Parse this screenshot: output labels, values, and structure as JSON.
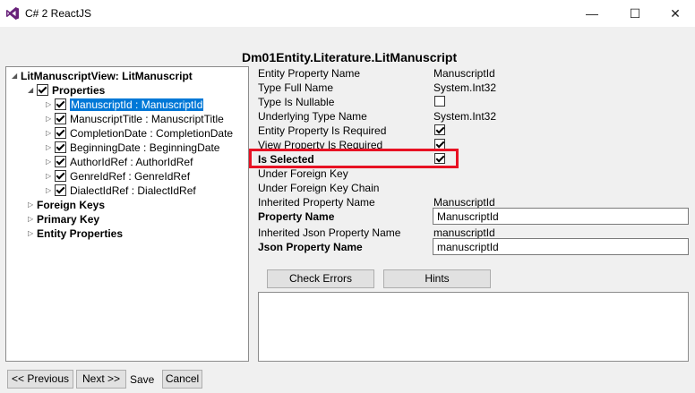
{
  "window": {
    "title": "C# 2 ReactJS",
    "minimize_glyph": "—",
    "maximize_glyph": "☐",
    "close_glyph": "✕"
  },
  "header": {
    "entity_title": "Dm01Entity.Literature.LitManuscript"
  },
  "tree": {
    "root": {
      "label": "LitManuscriptView: LitManuscript",
      "expander": "◢"
    },
    "properties": {
      "label": "Properties",
      "expander": "◢",
      "checked": true
    },
    "items": [
      {
        "label": "ManuscriptId : ManuscriptId",
        "checked": true,
        "selected": true
      },
      {
        "label": "ManuscriptTitle : ManuscriptTitle",
        "checked": true
      },
      {
        "label": "CompletionDate : CompletionDate",
        "checked": true
      },
      {
        "label": "BeginningDate : BeginningDate",
        "checked": true
      },
      {
        "label": "AuthorIdRef : AuthorIdRef",
        "checked": true
      },
      {
        "label": "GenreIdRef : GenreIdRef",
        "checked": true
      },
      {
        "label": "DialectIdRef : DialectIdRef",
        "checked": true
      }
    ],
    "item_expander": "▷",
    "sections": [
      {
        "label": "Foreign Keys",
        "expander": "▷"
      },
      {
        "label": "Primary Key",
        "expander": "▷"
      },
      {
        "label": "Entity Properties",
        "expander": "▷"
      }
    ]
  },
  "properties": {
    "entity_property_name": {
      "label": "Entity Property Name",
      "value": "ManuscriptId"
    },
    "type_full_name": {
      "label": "Type Full Name",
      "value": "System.Int32"
    },
    "type_is_nullable": {
      "label": "Type Is Nullable",
      "checked": false
    },
    "underlying_type_name": {
      "label": "Underlying Type Name",
      "value": "System.Int32"
    },
    "entity_property_is_required": {
      "label": "Entity Property Is Required",
      "checked": true
    },
    "view_property_is_required": {
      "label": "View Property Is Required",
      "checked": true
    },
    "is_selected": {
      "label": "Is Selected",
      "checked": true
    },
    "under_foreign_key": {
      "label": "Under Foreign Key"
    },
    "under_foreign_key_chain": {
      "label": "Under Foreign Key Chain"
    },
    "inherited_property_name": {
      "label": "Inherited Property Name",
      "value": "ManuscriptId"
    },
    "property_name": {
      "label": "Property Name",
      "value": "ManuscriptId"
    },
    "inherited_json_property_name": {
      "label": "Inherited Json Property Name",
      "value": "manuscriptId"
    },
    "json_property_name": {
      "label": "Json Property Name",
      "value": "manuscriptId"
    }
  },
  "actions": {
    "check_errors": "Check Errors",
    "hints": "Hints"
  },
  "nav": {
    "previous": "<< Previous",
    "next": "Next >>",
    "save": "Save",
    "cancel": "Cancel"
  },
  "colors": {
    "selection": "#0078d7",
    "highlight": "#e81123",
    "app_icon": "#68217a"
  }
}
